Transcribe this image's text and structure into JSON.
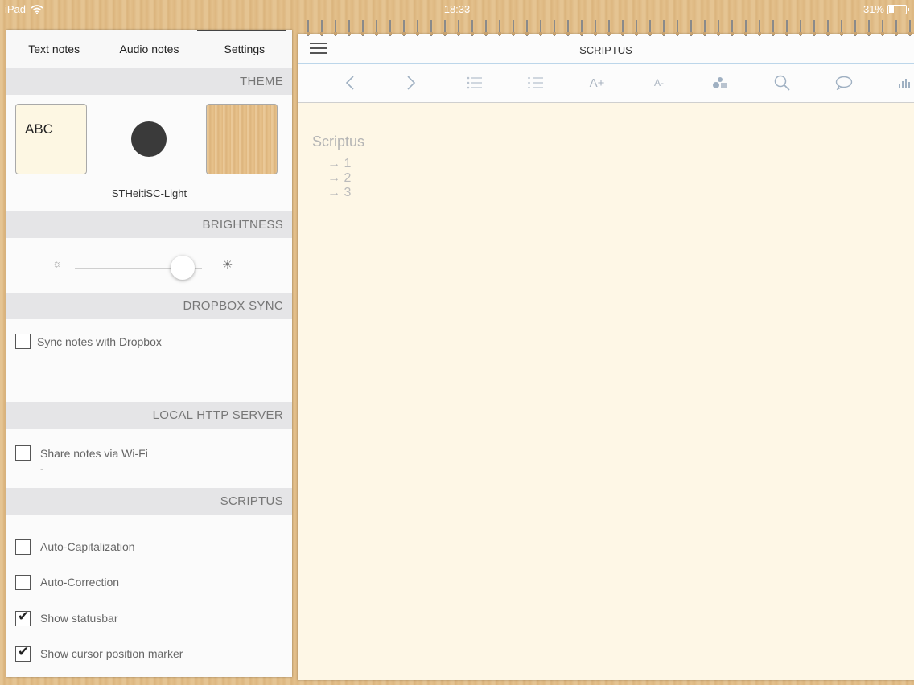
{
  "status_bar": {
    "device": "iPad",
    "time": "18:33",
    "battery": "31%",
    "battery_level": 0.31
  },
  "settings_panel": {
    "tabs": [
      {
        "label": "Text notes"
      },
      {
        "label": "Audio notes"
      },
      {
        "label": "Settings"
      }
    ],
    "active_tab": 2,
    "theme": {
      "header": "THEME",
      "light_swatch_label": "ABC",
      "font_name": "STHeitiSC-Light"
    },
    "brightness": {
      "header": "BRIGHTNESS",
      "level": 0.85
    },
    "dropbox": {
      "header": "DROPBOX SYNC",
      "sync_label": "Sync notes with Dropbox",
      "sync_checked": false
    },
    "http_server": {
      "header": "LOCAL HTTP SERVER",
      "share_label": "Share notes via Wi-Fi",
      "share_checked": false,
      "address": "-"
    },
    "scriptus": {
      "header": "SCRIPTUS",
      "options": [
        {
          "label": "Auto-Capitalization",
          "checked": false
        },
        {
          "label": "Auto-Correction",
          "checked": false
        },
        {
          "label": "Show statusbar",
          "checked": true
        },
        {
          "label": "Show cursor position marker",
          "checked": true
        }
      ]
    }
  },
  "notebook": {
    "title": "SCRIPTUS",
    "toolbar_icons": [
      "chevron-left-icon",
      "chevron-right-icon",
      "bulleted-list-icon",
      "checklist-icon",
      "increase-font-icon",
      "decrease-font-icon",
      "shapes-icon",
      "search-icon",
      "comment-icon",
      "statistics-icon"
    ],
    "toolbar_glyphs": {
      "font_increase": "A+",
      "font_decrease": "A-"
    },
    "document": {
      "title": "Scriptus",
      "lines": [
        "→ 1",
        "→ 2",
        "→ 3"
      ]
    }
  }
}
